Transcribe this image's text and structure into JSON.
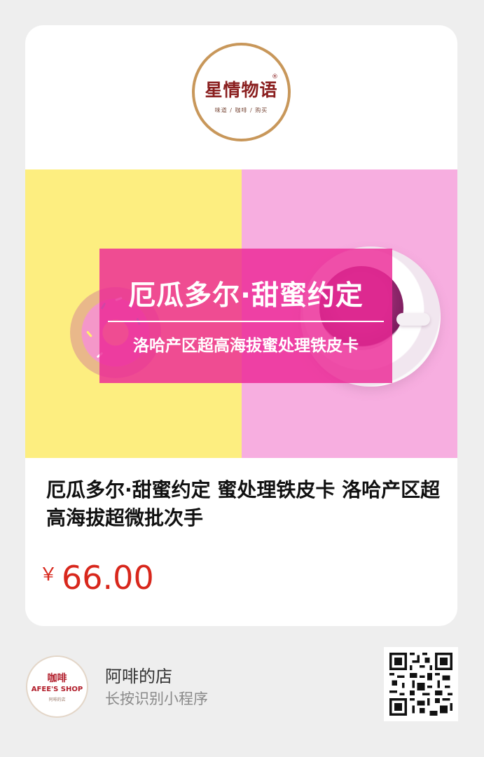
{
  "brand": {
    "wordmark": "星情物语",
    "registered": "®",
    "tagline": "味道 / 咖啡 / 购买"
  },
  "product_image": {
    "banner_title": "厄瓜多尔·甜蜜约定",
    "banner_subtitle": "洛哈产区超高海拔蜜处理铁皮卡",
    "colors": {
      "left_bg": "#fdee80",
      "right_bg": "#f7aee0",
      "banner": "#ec2896"
    }
  },
  "product": {
    "title": "厄瓜多尔·甜蜜约定 蜜处理铁皮卡 洛哈产区超高海拔超微批次手",
    "currency": "￥",
    "price": "66.00",
    "price_color": "#d8271c"
  },
  "shop": {
    "avatar_logo": "咖啡",
    "avatar_name": "AFEE'S SHOP",
    "avatar_sub": "阿啡的店",
    "name": "阿啡的店",
    "hint": "长按识别小程序",
    "qr_icon": "qr-code-icon"
  }
}
